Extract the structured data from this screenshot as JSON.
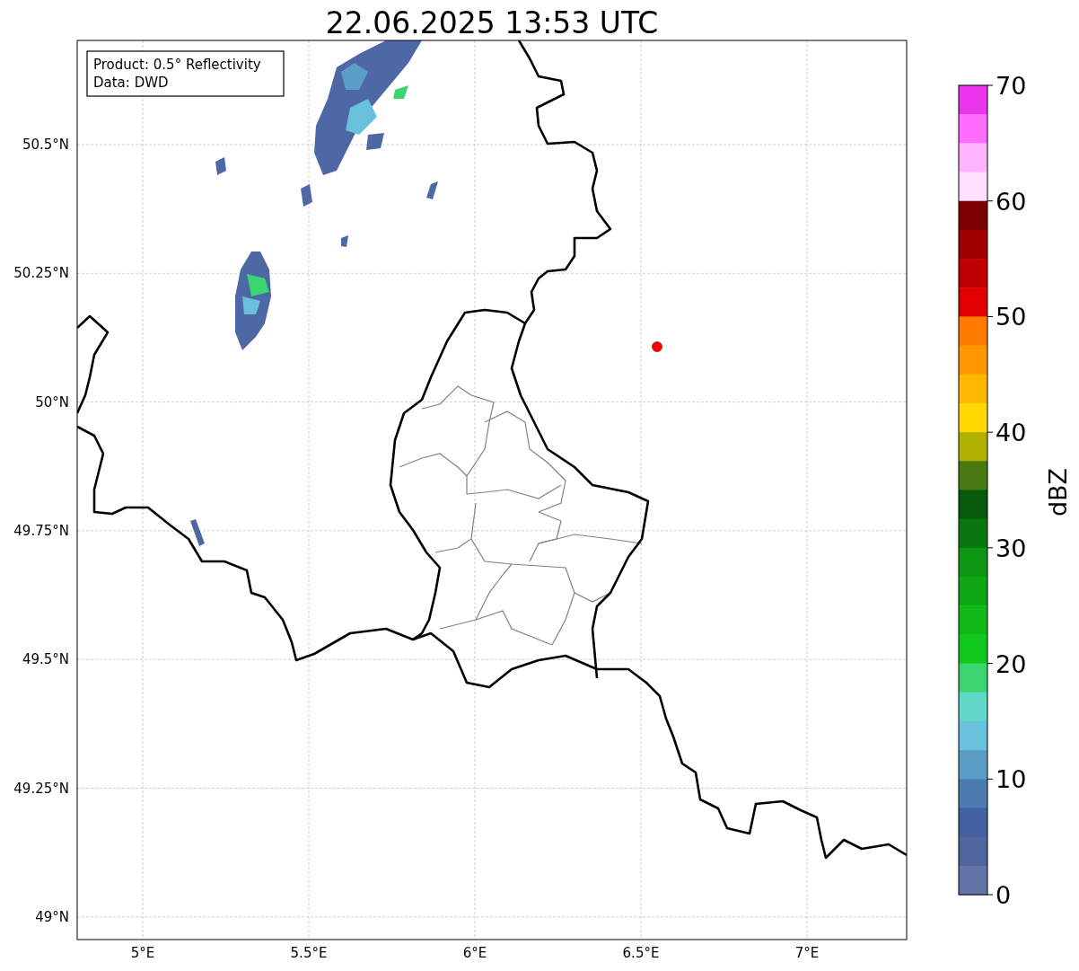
{
  "title": "22.06.2025 13:53 UTC",
  "info_box": {
    "lines": [
      "Product: 0.5° Reflectivity",
      "Data: DWD"
    ]
  },
  "map": {
    "y_ticks": [
      "50.5°N",
      "50.25°N",
      "50°N",
      "49.75°N",
      "49.5°N",
      "49.25°N",
      "49°N"
    ],
    "x_ticks": [
      "5°E",
      "5.5°E",
      "6°E",
      "6.5°E",
      "7°E"
    ],
    "station": {
      "color": "#ff0000"
    }
  },
  "colorbar": {
    "label": "dBZ",
    "ticks": [
      "70",
      "60",
      "50",
      "40",
      "30",
      "20",
      "10",
      "0"
    ],
    "segments": [
      {
        "color": "#ec34ec"
      },
      {
        "color": "#ff6cff"
      },
      {
        "color": "#ffb4ff"
      },
      {
        "color": "#ffe0ff"
      },
      {
        "color": "#7c0000"
      },
      {
        "color": "#a00000"
      },
      {
        "color": "#c00000"
      },
      {
        "color": "#e00000"
      },
      {
        "color": "#ff7c00"
      },
      {
        "color": "#ff9800"
      },
      {
        "color": "#ffb800"
      },
      {
        "color": "#ffd800"
      },
      {
        "color": "#b0b000"
      },
      {
        "color": "#487810"
      },
      {
        "color": "#085a0c"
      },
      {
        "color": "#0a7810"
      },
      {
        "color": "#0c9612"
      },
      {
        "color": "#0ea814"
      },
      {
        "color": "#10b818"
      },
      {
        "color": "#10c81c"
      },
      {
        "color": "#3cd470"
      },
      {
        "color": "#60d8c8"
      },
      {
        "color": "#68c2dc"
      },
      {
        "color": "#5a9ec6"
      },
      {
        "color": "#4a7ab0"
      },
      {
        "color": "#4360a2"
      },
      {
        "color": "#5166a0"
      },
      {
        "color": "#6474a6"
      }
    ]
  }
}
